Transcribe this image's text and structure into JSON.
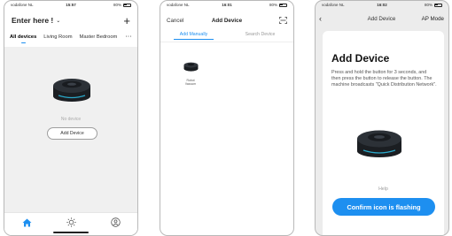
{
  "screen1": {
    "status": {
      "carrier": "vodafone NL",
      "time": "15:57",
      "battery": "80%"
    },
    "home_title": "Enter here !",
    "tabs": [
      "All devices",
      "Living Room",
      "Master Bedroom"
    ],
    "active_tab": "All devices",
    "empty_text": "No device",
    "add_device_label": "Add Device",
    "bottom_tabs": [
      "home-icon",
      "sun-icon",
      "profile-icon"
    ],
    "accent_color": "#1d8ff0"
  },
  "screen2": {
    "status": {
      "carrier": "vodafone NL",
      "time": "16:01",
      "battery": "80%"
    },
    "cancel_label": "Cancel",
    "title": "Add Device",
    "subtabs": {
      "manual": "Add Manually",
      "search": "Search Device"
    },
    "device_item": {
      "label_line1": "Robot",
      "label_line2": "Vacuum"
    }
  },
  "screen3": {
    "status": {
      "carrier": "vodafone NL",
      "time": "16:02",
      "battery": "80%"
    },
    "title": "Add Device",
    "mode_label": "AP Mode",
    "heading": "Add Device",
    "description": "Press and hold the button for 3 seconds, and then press the button to release the button. The machine broadcasts \"Quick Distribution Network\".",
    "help_label": "Help",
    "confirm_label": "Confirm icon is flashing"
  }
}
